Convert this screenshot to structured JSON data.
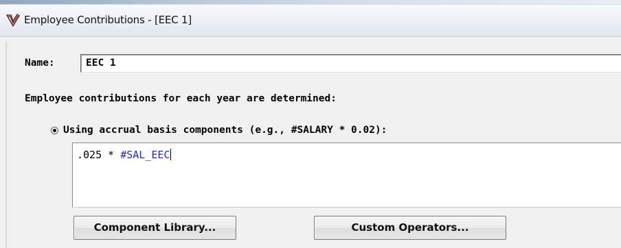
{
  "window": {
    "title": "Employee Contributions - [EEC 1]",
    "icon": "checkmark-logo-icon"
  },
  "form": {
    "name_label": "Name:",
    "name_value": "EEC 1",
    "section_label": "Employee contributions for each year are determined:",
    "radio_option_label": "Using accrual basis components (e.g., #SALARY * 0.02):",
    "radio_selected": true,
    "formula": {
      "number": ".025",
      "operator": " * ",
      "variable": "#SAL_EEC"
    }
  },
  "buttons": {
    "component_library_label": "Component Library...",
    "custom_operators_label": "Custom Operators..."
  },
  "colors": {
    "formula_variable": "#1a2bd6",
    "window_background": "#f0f0f0"
  }
}
